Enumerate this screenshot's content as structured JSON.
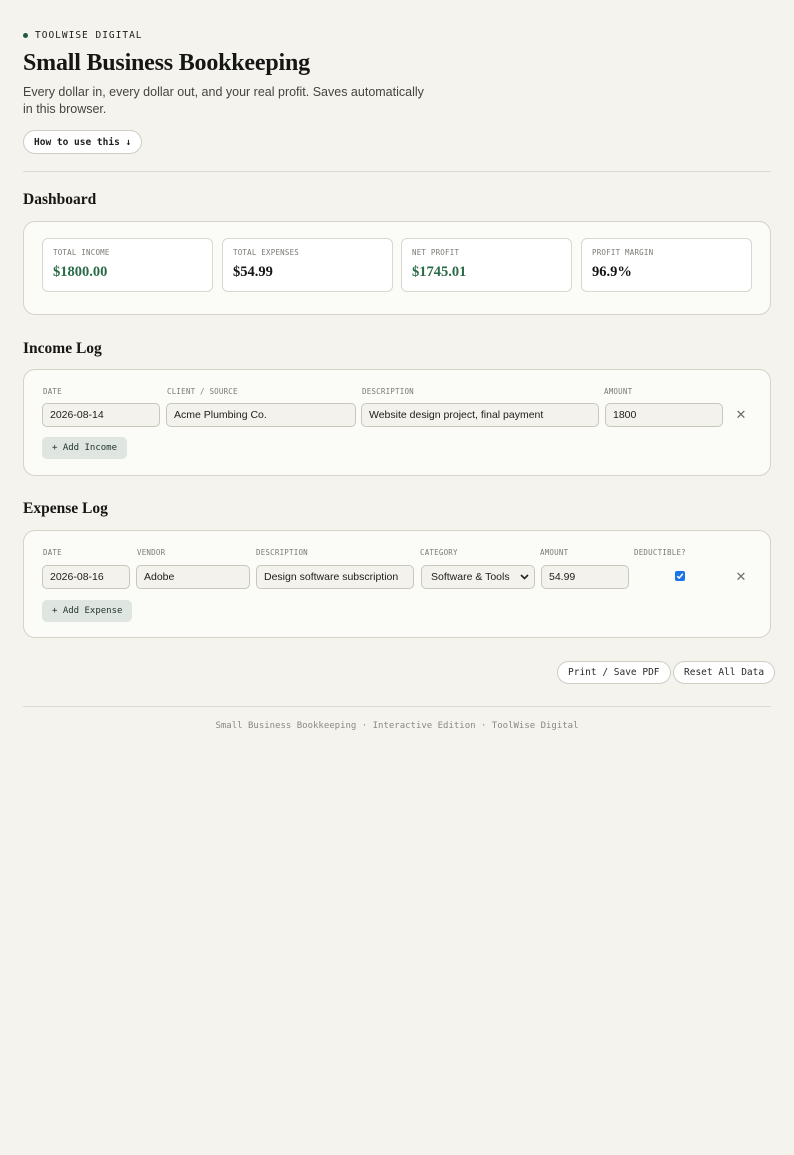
{
  "brand": {
    "name": "TOOLWISE DIGITAL"
  },
  "header": {
    "title": "Small Business Bookkeeping",
    "subtitle": "Every dollar in, every dollar out, and your real profit. Saves automatically in this browser.",
    "howto_label": "How to use this ↓"
  },
  "dashboard": {
    "title": "Dashboard",
    "stats": [
      {
        "label": "TOTAL INCOME",
        "value": "$1800.00",
        "color": "#2a6b47"
      },
      {
        "label": "TOTAL EXPENSES",
        "value": "$54.99",
        "color": "#161614"
      },
      {
        "label": "NET PROFIT",
        "value": "$1745.01",
        "color": "#2a6b47"
      },
      {
        "label": "PROFIT MARGIN",
        "value": "96.9%",
        "color": "#161614"
      }
    ]
  },
  "income": {
    "title": "Income Log",
    "columns": [
      "DATE",
      "CLIENT / SOURCE",
      "DESCRIPTION",
      "AMOUNT"
    ],
    "rows": [
      {
        "date": "2026-08-14",
        "client": "Acme Plumbing Co.",
        "description": "Website design project, final payment",
        "amount": "1800"
      }
    ],
    "add_label": "+ Add Income"
  },
  "expenses": {
    "title": "Expense Log",
    "columns": [
      "DATE",
      "VENDOR",
      "DESCRIPTION",
      "CATEGORY",
      "AMOUNT",
      "DEDUCTIBLE?"
    ],
    "rows": [
      {
        "date": "2026-08-16",
        "vendor": "Adobe",
        "description": "Design software subscription",
        "category": "Software & Tools",
        "amount": "54.99",
        "deductible": true
      }
    ],
    "add_label": "+ Add Expense"
  },
  "actions": {
    "print_label": "Print / Save PDF",
    "reset_label": "Reset All Data"
  },
  "footer": {
    "text": "Small Business Bookkeeping · Interactive Edition · ToolWise Digital"
  },
  "icons": {
    "remove": "close-icon",
    "select_arrow": "chevron-down-icon",
    "check": "check-icon"
  }
}
